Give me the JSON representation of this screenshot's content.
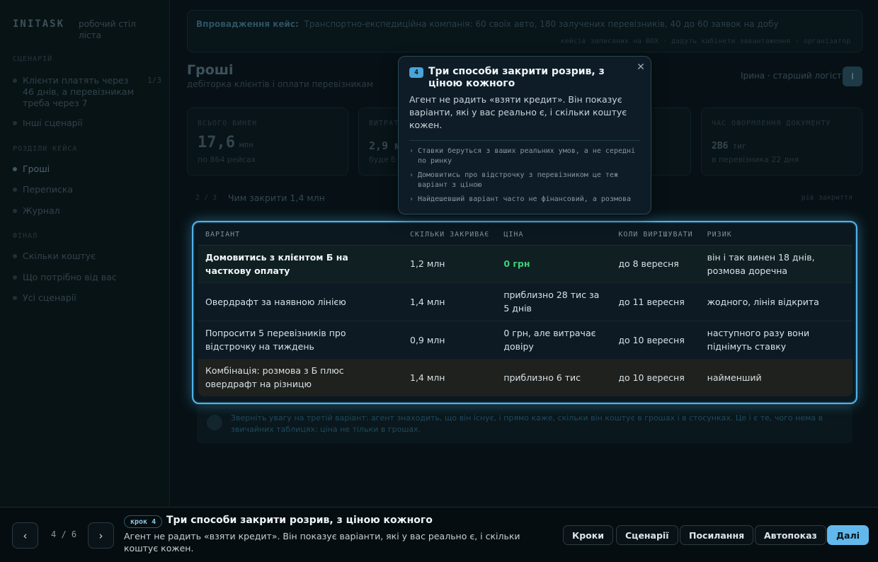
{
  "sidebar": {
    "logo": "INITASK",
    "subtitle": "робочий стіл ліста",
    "section_1": "СЦЕНАРІЙ",
    "scenario_item": "Клієнти платять через 46 днів, а перевізникам треба через 7",
    "scenario_count": "1/3",
    "other_scenarios": "Інші сценарії",
    "section_2": "РОЗДІЛИ КЕЙСА",
    "items": [
      "Гроші",
      "Переписка",
      "Журнал"
    ],
    "section_3": "ФІНАЛ",
    "final_items": [
      "Скільки коштує",
      "Що потрібно від вас",
      "Усі сценарії"
    ]
  },
  "banner": {
    "label": "Впровадження кейс:",
    "text": "Транспортно-експедиційна компанія: 60 своїх авто, 180 залучених перевізників, 40 до 60 заявок на добу",
    "sub": "кейсів записаних на BOX · дадуть кабінети завантаження · організатор"
  },
  "header": {
    "title": "Гроші",
    "subtitle": "дебіторка клієнтів і оплати перевізникам",
    "persona": "Ірина · старший логіст",
    "avatar": "І"
  },
  "kpis": [
    {
      "label": "ВСЬОГО ВИНЕН",
      "value": "17,6",
      "unit": "млн",
      "note": "по 864 рейсах"
    },
    {
      "label": "ВИТРАТИ",
      "value": "2,9 м",
      "unit": "",
      "note": "буде б"
    },
    {
      "label": "",
      "value": "",
      "unit": "",
      "note": ""
    },
    {
      "label": "ЧАС ОФОРМЛЕННЯ ДОКУМЕНТУ",
      "value": "2В6",
      "unit": "тиг",
      "note": "в перевізника 22 дня"
    }
  ],
  "row_head": {
    "num": "2 / 3",
    "title": "Чим закрити 1,4 млн",
    "right": "рів закриття"
  },
  "table": {
    "headers": [
      "ВАРІАНТ",
      "СКІЛЬКИ ЗАКРИВАЄ",
      "ЦІНА",
      "КОЛИ ВИРІШУВАТИ",
      "РИЗИК"
    ],
    "rows": [
      [
        "Домовитись з клієнтом Б на часткову оплату",
        "1,2 млн",
        "0 грн",
        "до 8 вересня",
        "він і так винен 18 днів, розмова доречна"
      ],
      [
        "Овердрафт за наявною лінією",
        "1,4 млн",
        "приблизно 28 тис за 5 днів",
        "до 11 вересня",
        "жодного, лінія відкрита"
      ],
      [
        "Попросити 5 перевізників про відстрочку на тиждень",
        "0,9 млн",
        "0 грн, але витрачає довіру",
        "до 10 вересня",
        "наступного разу вони піднімуть ставку"
      ],
      [
        "Комбінація: розмова з Б плюс овердрафт на різницю",
        "1,4 млн",
        "приблизно 6 тис",
        "до 10 вересня",
        "найменший"
      ]
    ]
  },
  "note": "Зверніть увагу на третій варіант: агент знаходить, що він існує, і прямо каже, скільки він коштує в грошах і в стосунках. Це і є те, чого нема в звичайних таблицях: ціна не тільки в грошах.",
  "popover": {
    "step": "4",
    "title": "Три способи закрити розрив, з ціною кожного",
    "body": "Агент не радить «взяти кредит». Він показує варіанти, які у вас реально є, і скільки коштує кожен.",
    "bullets": [
      "Ставки беруться з ваших реальних умов, а не середні по ринку",
      "Домовитись про відстрочку з перевізником це теж варіант з ціною",
      "Найдешевший варіант часто не фінансовий, а розмова"
    ]
  },
  "bottom": {
    "counter": "4 / 6",
    "step_chip": "крок 4",
    "title": "Три способи закрити розрив, з ціною кожного",
    "desc": "Агент не радить «взяти кредит». Він показує варіанти, які у вас реально є, і скільки коштує кожен.",
    "buttons": [
      "Кроки",
      "Сценарії",
      "Посилання",
      "Автопоказ",
      "Далі"
    ],
    "prev_glyph": "‹",
    "next_glyph": "›"
  },
  "colors": {
    "accent": "#4fb2e8",
    "green": "#3fd07a",
    "bg": "#071115"
  }
}
